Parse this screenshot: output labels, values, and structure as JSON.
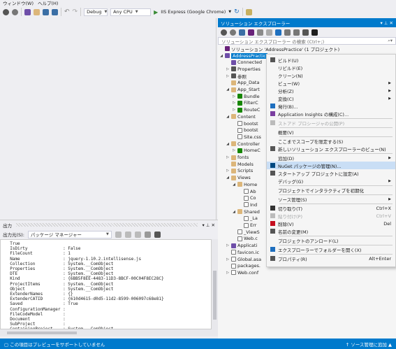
{
  "menubar": {
    "items": [
      "ウィンドウ(W)",
      "ヘルプ(H)"
    ]
  },
  "toolbar": {
    "config": "Debug",
    "platform": "Any CPU",
    "run_label": "IIS Express (Google Chrome)"
  },
  "solution_explorer": {
    "title": "ソリューション エクスプローラー",
    "search_placeholder": "ソリューション エクスプローラー の検索 (Ctrl+;)",
    "tree": [
      {
        "label": "ソリューション 'AddressPractice' (1 プロジェクト)",
        "depth": 0,
        "icon": "solution-icon",
        "expander": ""
      },
      {
        "label": "AddressPractic",
        "depth": 0,
        "icon": "project-icon",
        "expander": "◢",
        "selected": true
      },
      {
        "label": "Connected",
        "depth": 1,
        "icon": "connected-icon",
        "expander": ""
      },
      {
        "label": "Properties",
        "depth": 1,
        "icon": "wrench-icon",
        "expander": "▷"
      },
      {
        "label": "参照",
        "depth": 1,
        "icon": "reference-icon",
        "expander": "▷"
      },
      {
        "label": "App_Data",
        "depth": 1,
        "icon": "folder-icon",
        "expander": ""
      },
      {
        "label": "App_Start",
        "depth": 1,
        "icon": "folder-icon",
        "expander": "◢"
      },
      {
        "label": "Bundle",
        "depth": 2,
        "icon": "csharp-icon",
        "expander": "▷"
      },
      {
        "label": "FilterC",
        "depth": 2,
        "icon": "csharp-icon",
        "expander": "▷"
      },
      {
        "label": "RouteC",
        "depth": 2,
        "icon": "csharp-icon",
        "expander": "▷"
      },
      {
        "label": "Content",
        "depth": 1,
        "icon": "folder-icon",
        "expander": "◢"
      },
      {
        "label": "bootst",
        "depth": 2,
        "icon": "file-icon",
        "expander": ""
      },
      {
        "label": "bootst",
        "depth": 2,
        "icon": "file-icon",
        "expander": ""
      },
      {
        "label": "Site.css",
        "depth": 2,
        "icon": "file-icon",
        "expander": ""
      },
      {
        "label": "Controller",
        "depth": 1,
        "icon": "folder-icon",
        "expander": "◢"
      },
      {
        "label": "HomeC",
        "depth": 2,
        "icon": "csharp-icon",
        "expander": "▷"
      },
      {
        "label": "fonts",
        "depth": 1,
        "icon": "folder-icon",
        "expander": "▷"
      },
      {
        "label": "Models",
        "depth": 1,
        "icon": "folder-icon",
        "expander": ""
      },
      {
        "label": "Scripts",
        "depth": 1,
        "icon": "folder-icon",
        "expander": "▷"
      },
      {
        "label": "Views",
        "depth": 1,
        "icon": "folder-icon",
        "expander": "◢"
      },
      {
        "label": "Home",
        "depth": 2,
        "icon": "folder-icon",
        "expander": "◢"
      },
      {
        "label": "Ab",
        "depth": 3,
        "icon": "razor-icon",
        "expander": ""
      },
      {
        "label": "Co",
        "depth": 3,
        "icon": "razor-icon",
        "expander": ""
      },
      {
        "label": "Ind",
        "depth": 3,
        "icon": "razor-icon",
        "expander": ""
      },
      {
        "label": "Shared",
        "depth": 2,
        "icon": "folder-icon",
        "expander": "◢"
      },
      {
        "label": "_La",
        "depth": 3,
        "icon": "razor-icon",
        "expander": ""
      },
      {
        "label": "Err",
        "depth": 3,
        "icon": "razor-icon",
        "expander": ""
      },
      {
        "label": "_ViewS",
        "depth": 2,
        "icon": "razor-icon",
        "expander": ""
      },
      {
        "label": "Web.c",
        "depth": 2,
        "icon": "config-icon",
        "expander": ""
      },
      {
        "label": "Applicati",
        "depth": 1,
        "icon": "insights-icon",
        "expander": "▷"
      },
      {
        "label": "favicon.ic",
        "depth": 1,
        "icon": "file-icon",
        "expander": ""
      },
      {
        "label": "Global.asa",
        "depth": 1,
        "icon": "file-icon",
        "expander": "▷"
      },
      {
        "label": "packages.",
        "depth": 1,
        "icon": "config-icon",
        "expander": ""
      },
      {
        "label": "Web.conf",
        "depth": 1,
        "icon": "config-icon",
        "expander": "▷"
      }
    ]
  },
  "context_menu": {
    "items": [
      {
        "label": "ビルド(U)",
        "icon": "build-icon",
        "shortcut": "",
        "submenu": false,
        "disabled": false
      },
      {
        "label": "リビルド(E)",
        "icon": "",
        "shortcut": "",
        "submenu": false,
        "disabled": false
      },
      {
        "label": "クリーン(N)",
        "icon": "",
        "shortcut": "",
        "submenu": false,
        "disabled": false
      },
      {
        "label": "ビュー(W)",
        "icon": "",
        "shortcut": "",
        "submenu": true,
        "disabled": false
      },
      {
        "label": "分析(Z)",
        "icon": "",
        "shortcut": "",
        "submenu": true,
        "disabled": false
      },
      {
        "label": "変換(C)",
        "icon": "",
        "shortcut": "",
        "submenu": true,
        "disabled": false
      },
      {
        "label": "発行(B)...",
        "icon": "globe-icon",
        "shortcut": "",
        "submenu": false,
        "disabled": false
      },
      {
        "label": "Application Insights の構成(C)...",
        "icon": "insights-icon",
        "shortcut": "",
        "submenu": false,
        "disabled": false,
        "sep_after": true
      },
      {
        "label": "ストアド プロシージャの公開(P)",
        "icon": "stored-proc-icon",
        "shortcut": "",
        "submenu": false,
        "disabled": true,
        "sep_after": true
      },
      {
        "label": "概要(V)",
        "icon": "",
        "shortcut": "",
        "submenu": false,
        "disabled": false,
        "sep_after": true
      },
      {
        "label": "ここまでスコープを限定する(S)",
        "icon": "",
        "shortcut": "",
        "submenu": false,
        "disabled": false
      },
      {
        "label": "新しいソリューション エクスプローラーのビュー(N)",
        "icon": "new-view-icon",
        "shortcut": "",
        "submenu": false,
        "disabled": false,
        "sep_after": true
      },
      {
        "label": "追加(D)",
        "icon": "",
        "shortcut": "",
        "submenu": true,
        "disabled": false
      },
      {
        "label": "NuGet パッケージの管理(N)...",
        "icon": "nuget-icon",
        "shortcut": "",
        "submenu": false,
        "disabled": false,
        "highlighted": true
      },
      {
        "label": "スタートアップ プロジェクトに設定(A)",
        "icon": "gear-icon",
        "shortcut": "",
        "submenu": false,
        "disabled": false
      },
      {
        "label": "デバッグ(G)",
        "icon": "",
        "shortcut": "",
        "submenu": true,
        "disabled": false,
        "sep_after": true
      },
      {
        "label": "プロジェクトでインタラクティブを初期化",
        "icon": "",
        "shortcut": "",
        "submenu": false,
        "disabled": false,
        "sep_after": true
      },
      {
        "label": "ソース管理(S)",
        "icon": "",
        "shortcut": "",
        "submenu": true,
        "disabled": false,
        "sep_after": true
      },
      {
        "label": "切り取り(T)",
        "icon": "cut-icon",
        "shortcut": "Ctrl+X",
        "submenu": false,
        "disabled": false
      },
      {
        "label": "貼り付け(P)",
        "icon": "paste-icon",
        "shortcut": "Ctrl+V",
        "submenu": false,
        "disabled": true
      },
      {
        "label": "削除(V)",
        "icon": "delete-icon",
        "shortcut": "Del",
        "submenu": false,
        "disabled": false
      },
      {
        "label": "名前の変更(M)",
        "icon": "rename-icon",
        "shortcut": "",
        "submenu": false,
        "disabled": false,
        "sep_after": true
      },
      {
        "label": "プロジェクトのアンロード(L)",
        "icon": "",
        "shortcut": "",
        "submenu": false,
        "disabled": false,
        "sep_after": true
      },
      {
        "label": "エクスプローラーでフォルダーを開く(X)",
        "icon": "refresh-icon",
        "shortcut": "",
        "submenu": false,
        "disabled": false,
        "sep_after": true
      },
      {
        "label": "プロパティ(R)",
        "icon": "wrench-icon",
        "shortcut": "Alt+Enter",
        "submenu": false,
        "disabled": false
      }
    ]
  },
  "output": {
    "title": "出力",
    "source_label": "出力元(S):",
    "source_value": "パッケージ マネージャー",
    "lines": [
      "  True",
      "",
      "",
      "  IsDirty              : False",
      "  FileCount            : 1",
      "  Name                 : jquery-1.10.2.intellisense.js",
      "  Collection           : System.__ComObject",
      "  Properties           : System.__ComObject",
      "  DTE                  : System.__ComObject",
      "  Kind                 : {6BB5F8EE-4483-11D3-8BCF-00C04F8EC28C}",
      "  ProjectItems         : System.__ComObject",
      "  Object               : System.__ComObject",
      "  ExtenderNames        : {}",
      "  ExtenderCATID        : {610d4615-d0d5-11d2-8599-006097c68e81}",
      "  Saved                : True",
      "  ConfigurationManager :",
      "  FileCodeModel        :",
      "  Document             :",
      "  SubProject           :",
      "  ContainingProject    : System.__ComObject"
    ]
  },
  "statusbar": {
    "left": "この項目はプレビューをサポートしていません",
    "right": "↑ ソース管理に追加 ▲"
  },
  "colors": {
    "accent": "#007acc",
    "folder": "#dcb67a",
    "highlight": "#c9def5"
  }
}
